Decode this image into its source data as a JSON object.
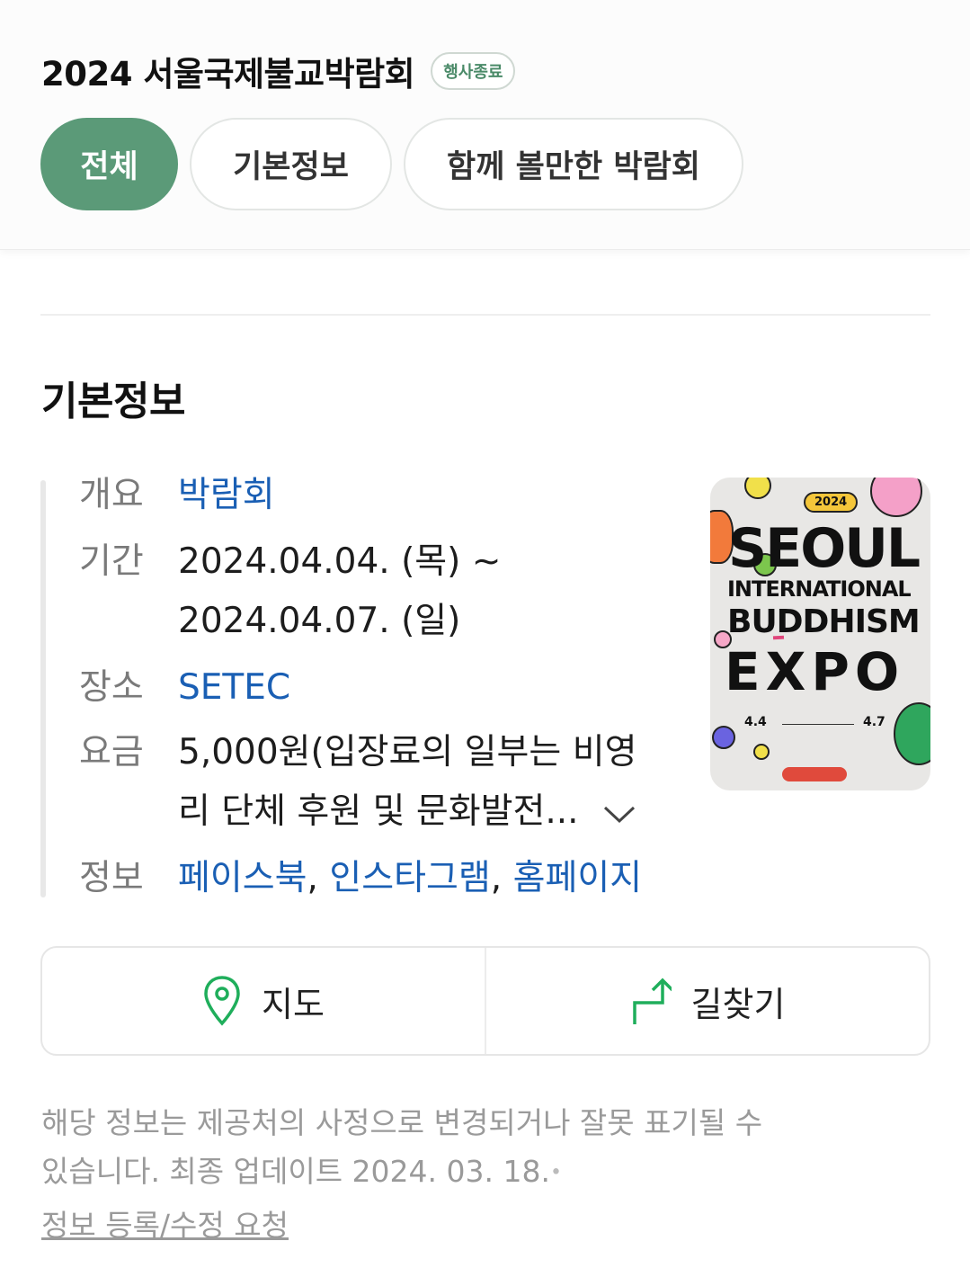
{
  "header": {
    "title": "2024 서울국제불교박람회",
    "status_badge": "행사종료",
    "tabs": [
      {
        "label": "전체",
        "active": true
      },
      {
        "label": "기본정보",
        "active": false
      },
      {
        "label": "함께 볼만한 박람회",
        "active": false
      }
    ]
  },
  "basic_info": {
    "section_title": "기본정보",
    "overview": {
      "label": "개요",
      "value": "박람회"
    },
    "period": {
      "label": "기간",
      "line1": "2024.04.04. (목) ~",
      "line2": "2024.04.07. (일)"
    },
    "place": {
      "label": "장소",
      "value": "SETEC"
    },
    "fee": {
      "label": "요금",
      "line1": "5,000원(입장료의 일부는 비영",
      "line2": "리 단체 후원 및 문화발전..."
    },
    "info": {
      "label": "정보",
      "links": [
        "페이스북",
        "인스타그램",
        "홈페이지"
      ],
      "separator": ","
    }
  },
  "poster": {
    "year": "2024",
    "line1": "SEOUL",
    "line2": "INTERNATIONAL",
    "line3": "BUDDHISM",
    "line4": "EXPO",
    "date_start": "4.4",
    "date_end": "4.7"
  },
  "actions": {
    "map_label": "지도",
    "directions_label": "길찾기",
    "icon_color": "#1fae5b"
  },
  "footer": {
    "notice_line1": "해당 정보는 제공처의 사정으로 변경되거나 잘못 표기될 수",
    "notice_line2": "있습니다. 최종 업데이트 2024. 03. 18.",
    "edit_link": "정보 등록/수정 요청"
  }
}
